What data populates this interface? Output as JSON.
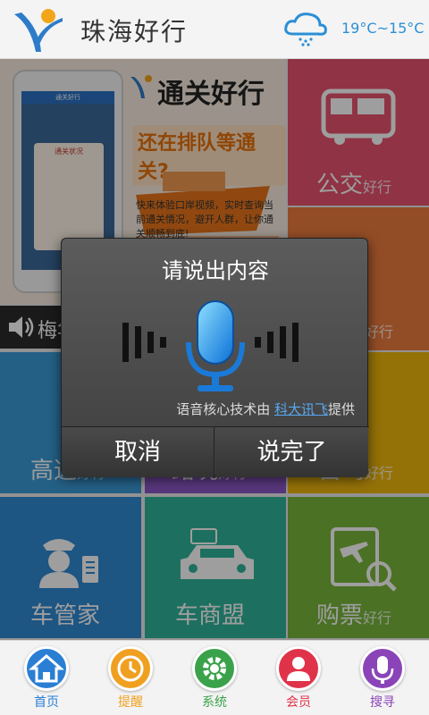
{
  "header": {
    "title": "珠海好行",
    "temperature": "19°C~15°C",
    "weather_icon": "cloud-rain-icon"
  },
  "banner": {
    "brand": "通关好行",
    "slogan": "还在排队等通关?",
    "description": "快来体验口岸视频，实时查询当前通关情况，避开人群，让你通关顺畅到底!",
    "phone_title": "通关好行",
    "phone_card_title": "通关状况"
  },
  "tiles": {
    "bus": {
      "label": "公交",
      "sub": "好行"
    },
    "second": {
      "sub": "好行"
    },
    "audio": {
      "label": "梅华"
    },
    "highway": {
      "label": "高速",
      "sub": "好行"
    },
    "road": {
      "label": "路况",
      "sub": "好行"
    },
    "yellow": {
      "label": "自驾",
      "sub": "好行"
    },
    "carmgr": {
      "label": "车管家"
    },
    "carshop": {
      "label": "车商盟"
    },
    "ticket": {
      "label": "购票",
      "sub": "好行"
    }
  },
  "dialog": {
    "title": "请说出内容",
    "provider_prefix": "语音核心技术由 ",
    "provider_link": "科大讯飞",
    "provider_suffix": "提供",
    "cancel": "取消",
    "done": "说完了"
  },
  "nav": [
    {
      "label": "首页",
      "color": "#2a7fd4",
      "icon": "home-icon"
    },
    {
      "label": "提醒",
      "color": "#f0a020",
      "icon": "clock-icon"
    },
    {
      "label": "系统",
      "color": "#3aa24a",
      "icon": "gear-icon"
    },
    {
      "label": "会员",
      "color": "#e0334a",
      "icon": "user-icon"
    },
    {
      "label": "搜寻",
      "color": "#8a44b8",
      "icon": "microphone-icon"
    }
  ]
}
